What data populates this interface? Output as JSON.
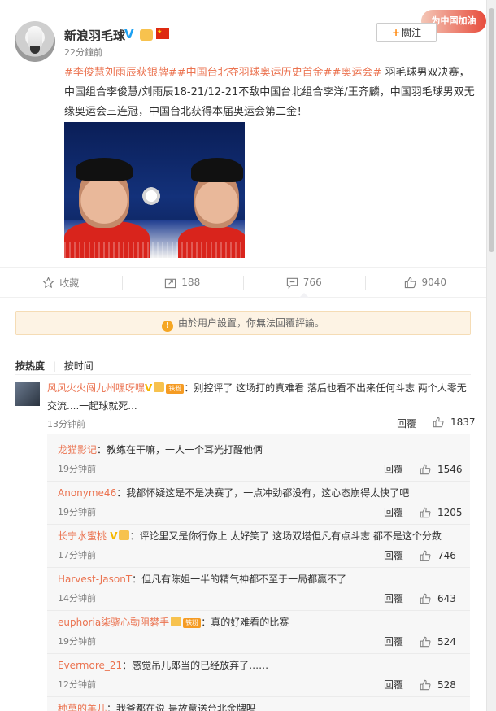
{
  "post": {
    "user_name": "新浪羽毛球",
    "verified_mark": "V",
    "time": "22分鐘前",
    "follow_label": "關注",
    "banner_text": "为中国加油",
    "tags": "#李俊慧刘雨辰获银牌##中国台北夺羽球奥运历史首金##奥运会#",
    "text": " 羽毛球男双决赛，中国组合李俊慧/刘雨辰18-21/12-21不敌中国台北组合李洋/王齐麟，中国羽毛球男双无缘奥运会三连冠，中国台北获得本届奥运会第二金！"
  },
  "actions": {
    "favorite_label": "收藏",
    "repost_count": "188",
    "comment_count": "766",
    "like_count": "9040"
  },
  "notice_text": "由於用户設置，你無法回覆評論。",
  "sort": {
    "hot_label": "按热度",
    "time_label": "按时间"
  },
  "main_comment": {
    "user": "风风火火闯九州嘿呀嘿",
    "vtag": "V",
    "fan_badge": "铁粉",
    "text": "：别控评了 这场打的真难看 落后也看不出来任何斗志 两个人零无交流....一起球就死...",
    "time": "13分钟前",
    "reply_label": "回覆",
    "likes": "1837"
  },
  "replies": [
    {
      "user": "龙猫影记",
      "text": "：教练在干嘛，一人一个耳光打醒他俩",
      "time": "19分钟前",
      "reply_label": "回覆",
      "likes": "1546"
    },
    {
      "user": "Anonyme46",
      "text": "：我都怀疑这是不是决赛了，一点冲劲都没有，这心态崩得太快了吧",
      "time": "19分钟前",
      "reply_label": "回覆",
      "likes": "1205"
    },
    {
      "user": "长宁水蜜桃",
      "text": "：评论里又是你行你上 太好笑了 这场双塔但凡有点斗志 都不是这个分数",
      "time": "17分钟前",
      "reply_label": "回覆",
      "likes": "746"
    },
    {
      "user": "Harvest-JasonT",
      "text": "：但凡有陈姐一半的精气神都不至于一局都赢不了",
      "time": "14分钟前",
      "reply_label": "回覆",
      "likes": "643"
    },
    {
      "user": "euphoria柒骁心動阻礬手",
      "text": "：真的好难看的比赛",
      "time": "19分钟前",
      "reply_label": "回覆",
      "likes": "524"
    },
    {
      "user": "Evermore_21",
      "text": "：感觉吊儿郎当的已经放弃了……",
      "time": "12分钟前",
      "reply_label": "回覆",
      "likes": "528"
    },
    {
      "user": "种草的羊儿",
      "text": "：我爸都在说 是故意送台北金牌吗",
      "time": "",
      "reply_label": "",
      "likes": ""
    }
  ]
}
